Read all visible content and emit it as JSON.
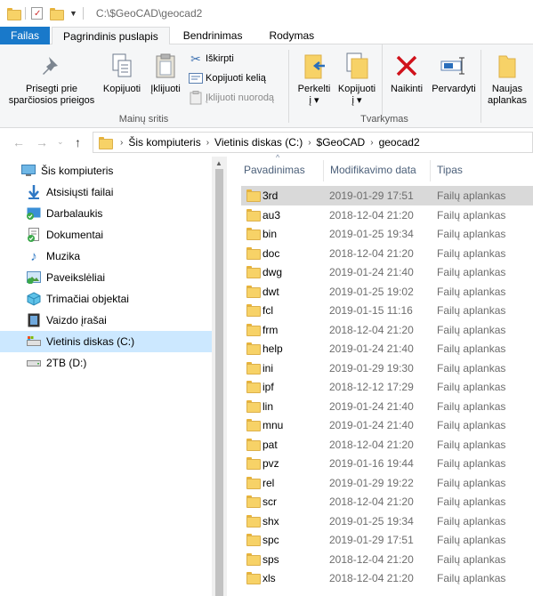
{
  "titlebar": {
    "path": "C:\\$GeoCAD\\geocad2"
  },
  "tabs": [
    {
      "label": "Failas"
    },
    {
      "label": "Pagrindinis puslapis"
    },
    {
      "label": "Bendrinimas"
    },
    {
      "label": "Rodymas"
    }
  ],
  "ribbon": {
    "pin": {
      "line1": "Prisegti prie",
      "line2": "sparčiosios prieigos"
    },
    "copy": "Kopijuoti",
    "paste": "Įklijuoti",
    "cut": "Iškirpti",
    "copy_path": "Kopijuoti kelią",
    "paste_shortcut": "Įklijuoti nuorodą",
    "group_clipboard": "Mainų sritis",
    "move_to": {
      "line1": "Perkelti",
      "line2": "į"
    },
    "copy_to": {
      "line1": "Kopijuoti",
      "line2": "į"
    },
    "delete": "Naikinti",
    "rename": "Pervardyti",
    "group_organize": "Tvarkymas",
    "new_folder": {
      "line1": "Naujas",
      "line2": "aplankas"
    }
  },
  "address": {
    "crumbs": [
      "Šis kompiuteris",
      "Vietinis diskas (C:)",
      "$GeoCAD",
      "geocad2"
    ]
  },
  "navpane": {
    "items": [
      {
        "label": "Šis kompiuteris",
        "icon": "computer-icon"
      },
      {
        "label": "Atsisiųsti failai",
        "icon": "download-icon"
      },
      {
        "label": "Darbalaukis",
        "icon": "desktop-icon"
      },
      {
        "label": "Dokumentai",
        "icon": "documents-icon"
      },
      {
        "label": "Muzika",
        "icon": "music-icon"
      },
      {
        "label": "Paveikslėliai",
        "icon": "pictures-icon"
      },
      {
        "label": "Trimačiai objektai",
        "icon": "3d-objects-icon"
      },
      {
        "label": "Vaizdo įrašai",
        "icon": "videos-icon"
      },
      {
        "label": "Vietinis diskas (C:)",
        "icon": "local-disk-icon"
      },
      {
        "label": "2TB (D:)",
        "icon": "drive-icon"
      }
    ]
  },
  "columns": {
    "name": "Pavadinimas",
    "modified": "Modifikavimo data",
    "type": "Tipas"
  },
  "files": [
    {
      "name": "3rd",
      "date": "2019-01-29 17:51",
      "type": "Failų aplankas"
    },
    {
      "name": "au3",
      "date": "2018-12-04 21:20",
      "type": "Failų aplankas"
    },
    {
      "name": "bin",
      "date": "2019-01-25 19:34",
      "type": "Failų aplankas"
    },
    {
      "name": "doc",
      "date": "2018-12-04 21:20",
      "type": "Failų aplankas"
    },
    {
      "name": "dwg",
      "date": "2019-01-24 21:40",
      "type": "Failų aplankas"
    },
    {
      "name": "dwt",
      "date": "2019-01-25 19:02",
      "type": "Failų aplankas"
    },
    {
      "name": "fcl",
      "date": "2019-01-15 11:16",
      "type": "Failų aplankas"
    },
    {
      "name": "frm",
      "date": "2018-12-04 21:20",
      "type": "Failų aplankas"
    },
    {
      "name": "help",
      "date": "2019-01-24 21:40",
      "type": "Failų aplankas"
    },
    {
      "name": "ini",
      "date": "2019-01-29 19:30",
      "type": "Failų aplankas"
    },
    {
      "name": "ipf",
      "date": "2018-12-12 17:29",
      "type": "Failų aplankas"
    },
    {
      "name": "lin",
      "date": "2019-01-24 21:40",
      "type": "Failų aplankas"
    },
    {
      "name": "mnu",
      "date": "2019-01-24 21:40",
      "type": "Failų aplankas"
    },
    {
      "name": "pat",
      "date": "2018-12-04 21:20",
      "type": "Failų aplankas"
    },
    {
      "name": "pvz",
      "date": "2019-01-16 19:44",
      "type": "Failų aplankas"
    },
    {
      "name": "rel",
      "date": "2019-01-29 19:22",
      "type": "Failų aplankas"
    },
    {
      "name": "scr",
      "date": "2018-12-04 21:20",
      "type": "Failų aplankas"
    },
    {
      "name": "shx",
      "date": "2019-01-25 19:34",
      "type": "Failų aplankas"
    },
    {
      "name": "spc",
      "date": "2019-01-29 17:51",
      "type": "Failų aplankas"
    },
    {
      "name": "sps",
      "date": "2018-12-04 21:20",
      "type": "Failų aplankas"
    },
    {
      "name": "xls",
      "date": "2018-12-04 21:20",
      "type": "Failų aplankas"
    }
  ]
}
